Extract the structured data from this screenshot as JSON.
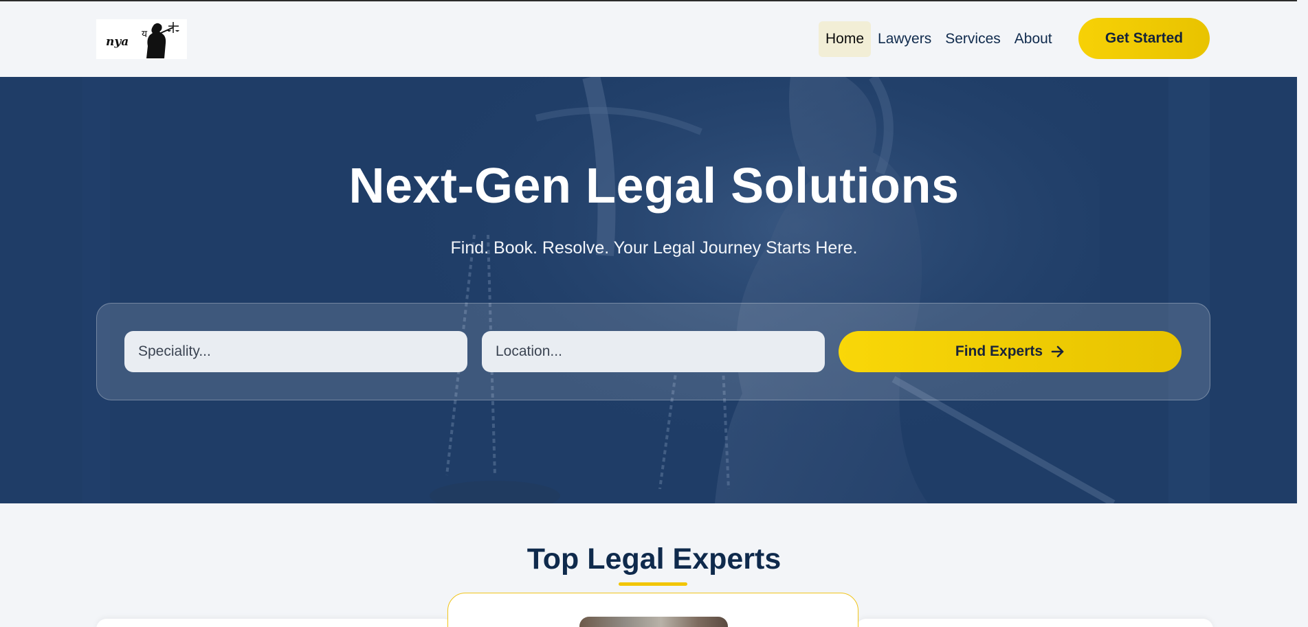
{
  "brand": {
    "logo_text": "nya",
    "logo_alt": "nyay-logo"
  },
  "nav": {
    "items": [
      {
        "label": "Home",
        "active": true
      },
      {
        "label": "Lawyers",
        "active": false
      },
      {
        "label": "Services",
        "active": false
      },
      {
        "label": "About",
        "active": false
      }
    ],
    "cta_label": "Get Started"
  },
  "hero": {
    "title": "Next-Gen Legal Solutions",
    "subtitle": "Find. Book. Resolve. Your Legal Journey Starts Here.",
    "search": {
      "speciality_placeholder": "Speciality...",
      "location_placeholder": "Location...",
      "button_label": "Find Experts",
      "button_icon": "arrow-right-icon"
    }
  },
  "section": {
    "title": "Top Legal Experts"
  },
  "colors": {
    "accent": "#f7d106",
    "navy": "#0f2a4c",
    "hero_bg": "#1f3d67",
    "page_bg": "#f3f5f8"
  }
}
